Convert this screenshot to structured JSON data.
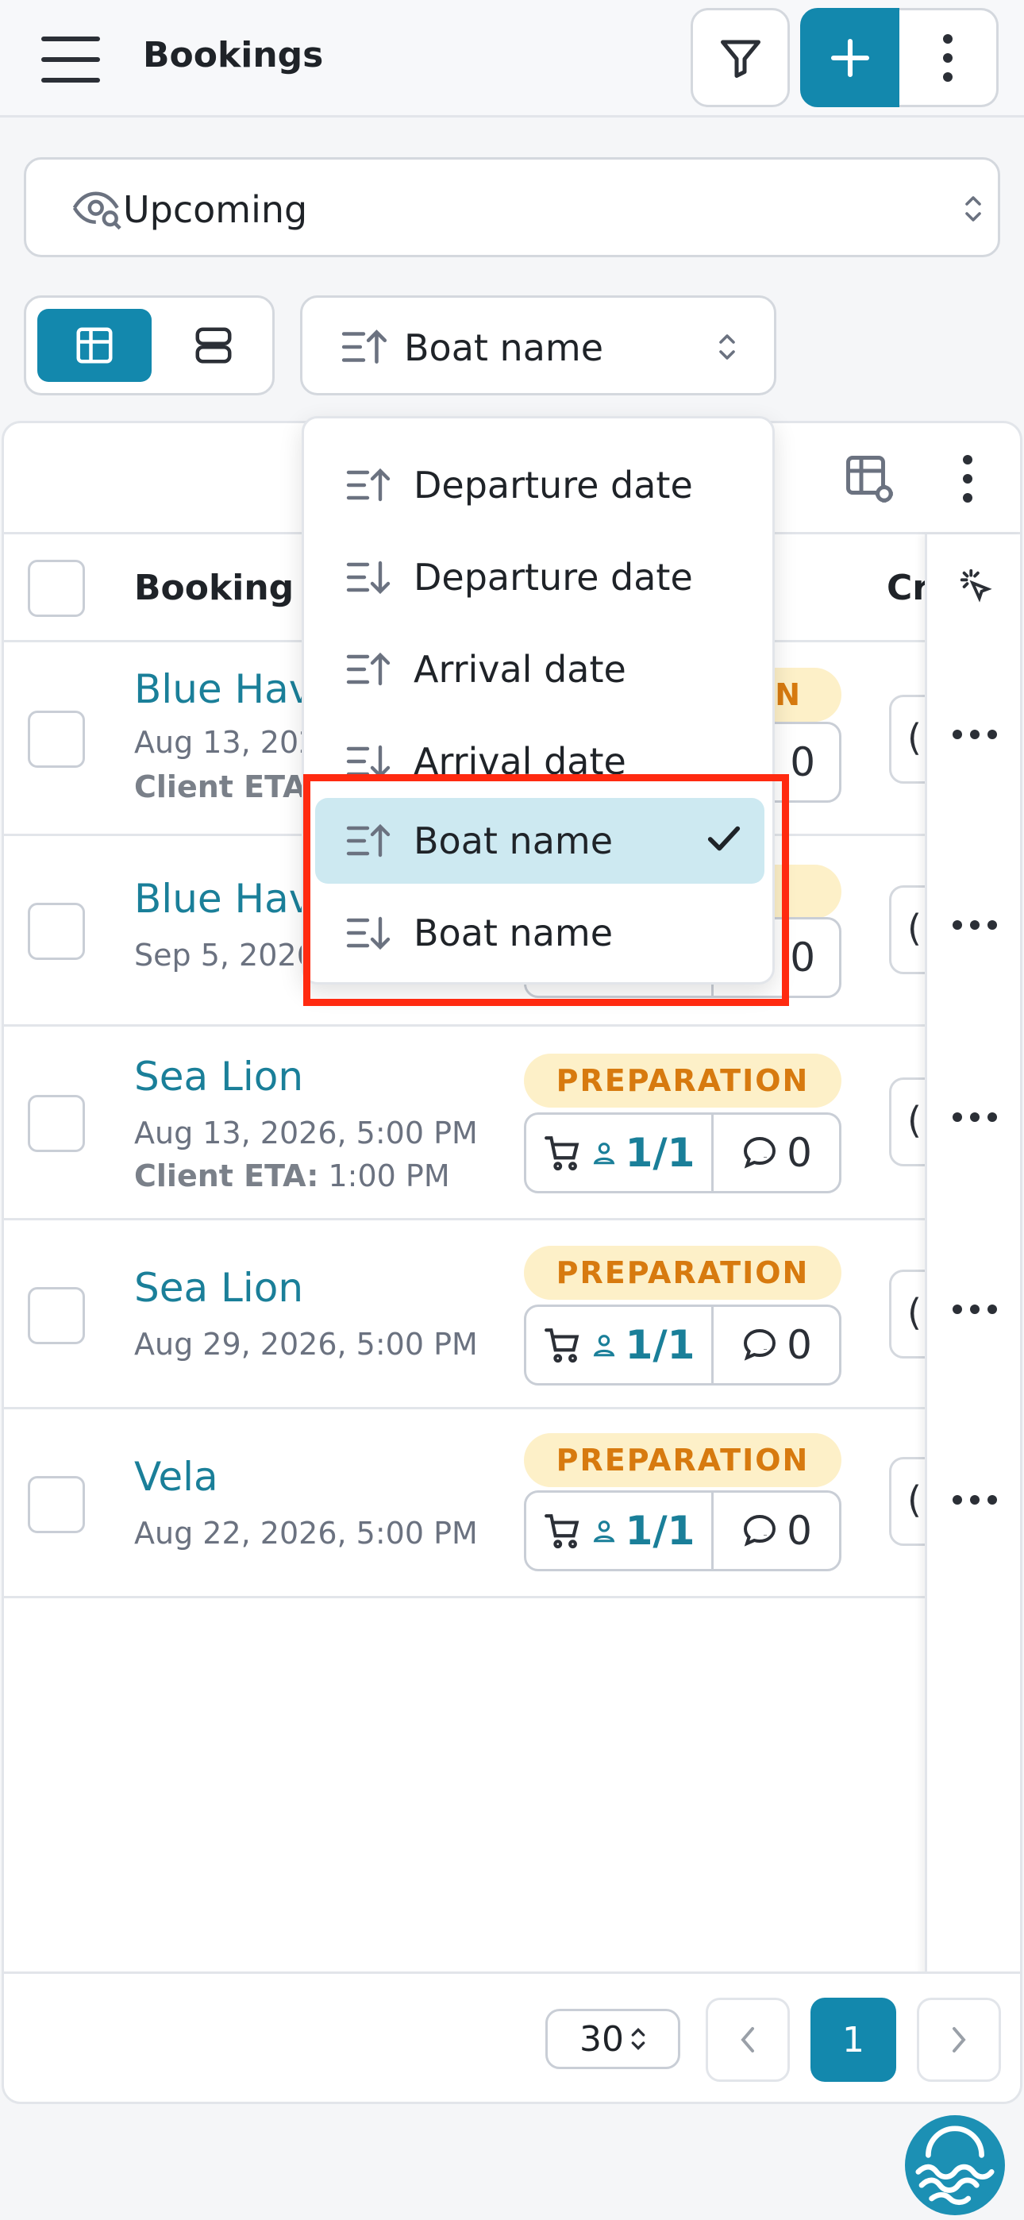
{
  "header": {
    "title": "Bookings",
    "add_label": "+"
  },
  "view_select": {
    "value": "Upcoming"
  },
  "layout_toggle": {
    "options": [
      "table-view",
      "card-view"
    ],
    "selected": "table-view"
  },
  "sort_select": {
    "value": "Boat name"
  },
  "table": {
    "columns": [
      "Booking",
      "Cr"
    ],
    "rows": [
      {
        "boat": "Blue Hav",
        "date": "Aug 13, 202",
        "eta_label": "Client ETA:",
        "eta": ""
      },
      {
        "boat": "Blue Hav",
        "date": "Sep 5, 2026"
      },
      {
        "boat": "Sea Lion",
        "date": "Aug 13, 2026, 5:00 PM",
        "eta_label": "Client ETA:",
        "eta": "1:00 PM",
        "status": "PREPARATION",
        "cart": "1/1",
        "comments": "0"
      },
      {
        "boat": "Sea Lion",
        "date": "Aug 29, 2026, 5:00 PM",
        "status": "PREPARATION",
        "cart": "1/1",
        "comments": "0"
      },
      {
        "boat": "Vela",
        "date": "Aug 22, 2026, 5:00 PM",
        "status": "PREPARATION",
        "cart": "1/1",
        "comments": "0"
      }
    ],
    "partial": {
      "row1_status_tail": "N",
      "row1_comments": "0",
      "row2_comments": "0",
      "created_chip": "("
    }
  },
  "sort_menu": {
    "items": [
      {
        "label": "Departure date",
        "dir": "asc"
      },
      {
        "label": "Departure date",
        "dir": "desc"
      },
      {
        "label": "Arrival date",
        "dir": "asc"
      },
      {
        "label": "Arrival date",
        "dir": "desc"
      },
      {
        "label": "Boat name",
        "dir": "asc",
        "selected": true
      },
      {
        "label": "Boat name",
        "dir": "desc"
      }
    ]
  },
  "pagination": {
    "per_page": "30",
    "current_page": "1"
  },
  "colors": {
    "accent": "#1388ad",
    "link": "#1a7f99",
    "badge_bg": "#fdf0c8",
    "badge_text": "#d77a0f",
    "highlight": "#ff2a10"
  }
}
